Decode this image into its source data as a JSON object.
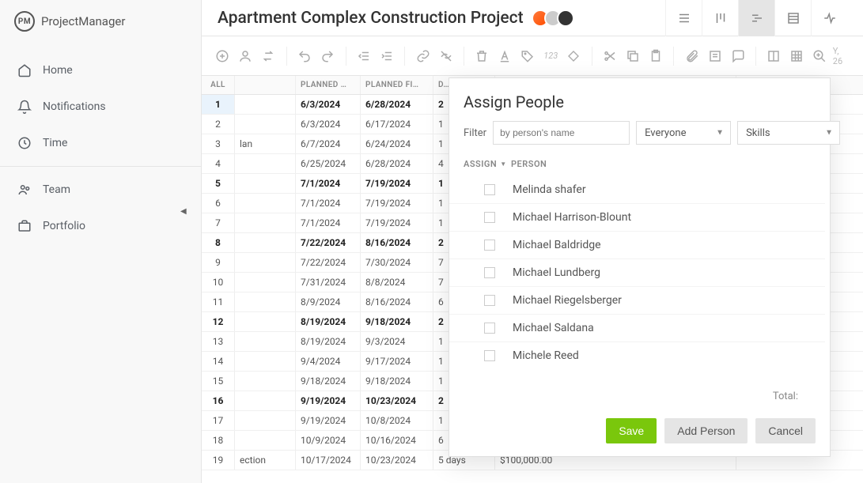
{
  "brand": {
    "mark": "PM",
    "name": "ProjectManager"
  },
  "nav": {
    "home": "Home",
    "notifications": "Notifications",
    "time": "Time",
    "team": "Team",
    "portfolio": "Portfolio"
  },
  "project": {
    "title": "Apartment Complex Construction Project",
    "date_hint": "Y, 26"
  },
  "grid": {
    "headers": {
      "all": "ALL",
      "planned_start": "PLANNED …",
      "planned_finish": "PLANNED FI…",
      "duration": "D…"
    },
    "rows": [
      {
        "n": "1",
        "name": "",
        "ps": "6/3/2024",
        "pf": "6/28/2024",
        "dur": "2",
        "cost": "",
        "bold": true,
        "sel": true
      },
      {
        "n": "2",
        "name": "",
        "ps": "6/3/2024",
        "pf": "6/17/2024",
        "dur": "1",
        "cost": "",
        "bold": false,
        "sel": false
      },
      {
        "n": "3",
        "name": "lan",
        "ps": "6/7/2024",
        "pf": "6/24/2024",
        "dur": "1",
        "cost": "",
        "bold": false,
        "sel": false
      },
      {
        "n": "4",
        "name": "",
        "ps": "6/25/2024",
        "pf": "6/28/2024",
        "dur": "4",
        "cost": "",
        "bold": false,
        "sel": false
      },
      {
        "n": "5",
        "name": "",
        "ps": "7/1/2024",
        "pf": "7/19/2024",
        "dur": "1",
        "cost": "",
        "bold": true,
        "sel": false
      },
      {
        "n": "6",
        "name": "",
        "ps": "7/1/2024",
        "pf": "7/19/2024",
        "dur": "1",
        "cost": "",
        "bold": false,
        "sel": false
      },
      {
        "n": "7",
        "name": "",
        "ps": "7/1/2024",
        "pf": "7/19/2024",
        "dur": "1",
        "cost": "",
        "bold": false,
        "sel": false
      },
      {
        "n": "8",
        "name": "",
        "ps": "7/22/2024",
        "pf": "8/16/2024",
        "dur": "2",
        "cost": "",
        "bold": true,
        "sel": false
      },
      {
        "n": "9",
        "name": "",
        "ps": "7/22/2024",
        "pf": "7/30/2024",
        "dur": "7",
        "cost": "",
        "bold": false,
        "sel": false
      },
      {
        "n": "10",
        "name": "",
        "ps": "7/31/2024",
        "pf": "8/8/2024",
        "dur": "7",
        "cost": "",
        "bold": false,
        "sel": false
      },
      {
        "n": "11",
        "name": "",
        "ps": "8/9/2024",
        "pf": "8/16/2024",
        "dur": "6",
        "cost": "",
        "bold": false,
        "sel": false
      },
      {
        "n": "12",
        "name": "",
        "ps": "8/19/2024",
        "pf": "9/18/2024",
        "dur": "2",
        "cost": "",
        "bold": true,
        "sel": false
      },
      {
        "n": "13",
        "name": "",
        "ps": "8/19/2024",
        "pf": "9/3/2024",
        "dur": "1",
        "cost": "",
        "bold": false,
        "sel": false
      },
      {
        "n": "14",
        "name": "",
        "ps": "9/4/2024",
        "pf": "9/17/2024",
        "dur": "1",
        "cost": "",
        "bold": false,
        "sel": false
      },
      {
        "n": "15",
        "name": "",
        "ps": "9/18/2024",
        "pf": "9/18/2024",
        "dur": "1",
        "cost": "",
        "bold": false,
        "sel": false
      },
      {
        "n": "16",
        "name": "",
        "ps": "9/19/2024",
        "pf": "10/23/2024",
        "dur": "2",
        "cost": "",
        "bold": true,
        "sel": false
      },
      {
        "n": "17",
        "name": "",
        "ps": "9/19/2024",
        "pf": "10/8/2024",
        "dur": "1",
        "cost": "",
        "bold": false,
        "sel": false
      },
      {
        "n": "18",
        "name": "",
        "ps": "10/9/2024",
        "pf": "10/16/2024",
        "dur": "6",
        "cost": "",
        "bold": false,
        "sel": false
      },
      {
        "n": "19",
        "name": "ection",
        "ps": "10/17/2024",
        "pf": "10/23/2024",
        "dur": "5 days",
        "cost": "$100,000.00",
        "bold": false,
        "sel": false
      }
    ]
  },
  "toolbar_num": "123",
  "modal": {
    "title": "Assign People",
    "filter_label": "Filter",
    "filter_placeholder": "by person's name",
    "select_everyone": "Everyone",
    "select_skills": "Skills",
    "col_assign": "ASSIGN",
    "col_person": "PERSON",
    "people": [
      "Melinda shafer",
      "Michael Harrison-Blount",
      "Michael Baldridge",
      "Michael Lundberg",
      "Michael Riegelsberger",
      "Michael Saldana",
      "Michele Reed"
    ],
    "total_label": "Total:",
    "btn_save": "Save",
    "btn_add": "Add Person",
    "btn_cancel": "Cancel"
  }
}
